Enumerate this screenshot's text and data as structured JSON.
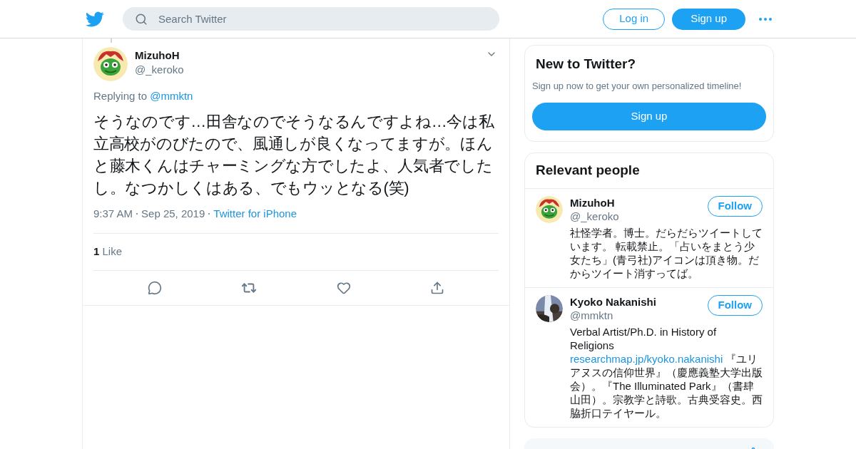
{
  "header": {
    "search": {
      "placeholder": "Search Twitter"
    },
    "login": "Log in",
    "signup": "Sign up"
  },
  "tweet": {
    "name": "MizuhoH",
    "handle": "@_keroko",
    "replying_label": "Replying to",
    "replying_to": "@mmktn",
    "text": "そうなのです…田舎なのでそうなるんですよね…今は私立高校がのびたので、風通しが良くなってますが。ほんと藤木くんはチャーミングな方でしたよ、人気者でしたし。なつかしくはある、でもウッとなる(笑)",
    "time": "9:37 AM",
    "date": "Sep 25, 2019",
    "source": "Twitter for iPhone",
    "likes_count": "1",
    "likes_label": "Like"
  },
  "new_to_twitter": {
    "title": "New to Twitter?",
    "text": "Sign up now to get your own personalized timeline!",
    "button": "Sign up"
  },
  "relevant_people": {
    "title": "Relevant people",
    "people": [
      {
        "name": "MizuhoH",
        "handle": "@_keroko",
        "kind": "frog",
        "follow": "Follow",
        "bio": "社怪学者。博士。だらだらツイートしています。 転載禁止。「占いをまとう少女たち」(青弓社)アイコンは頂き物。だからツイート消すってば。"
      },
      {
        "name": "Kyoko Nakanishi",
        "handle": "@mmktn",
        "kind": "picture",
        "follow": "Follow",
        "bio": "Verbal Artist/Ph.D. in History of Religions",
        "link": "researchmap.jp/kyoko.nakanishi",
        "bio_after": " 『ユリアヌスの信仰世界』（慶應義塾大学出版会）。『The Illuminated Park』（書肆山田）。宗教学と詩歌。古典受容史。西脇折口テイヤール。"
      }
    ]
  }
}
